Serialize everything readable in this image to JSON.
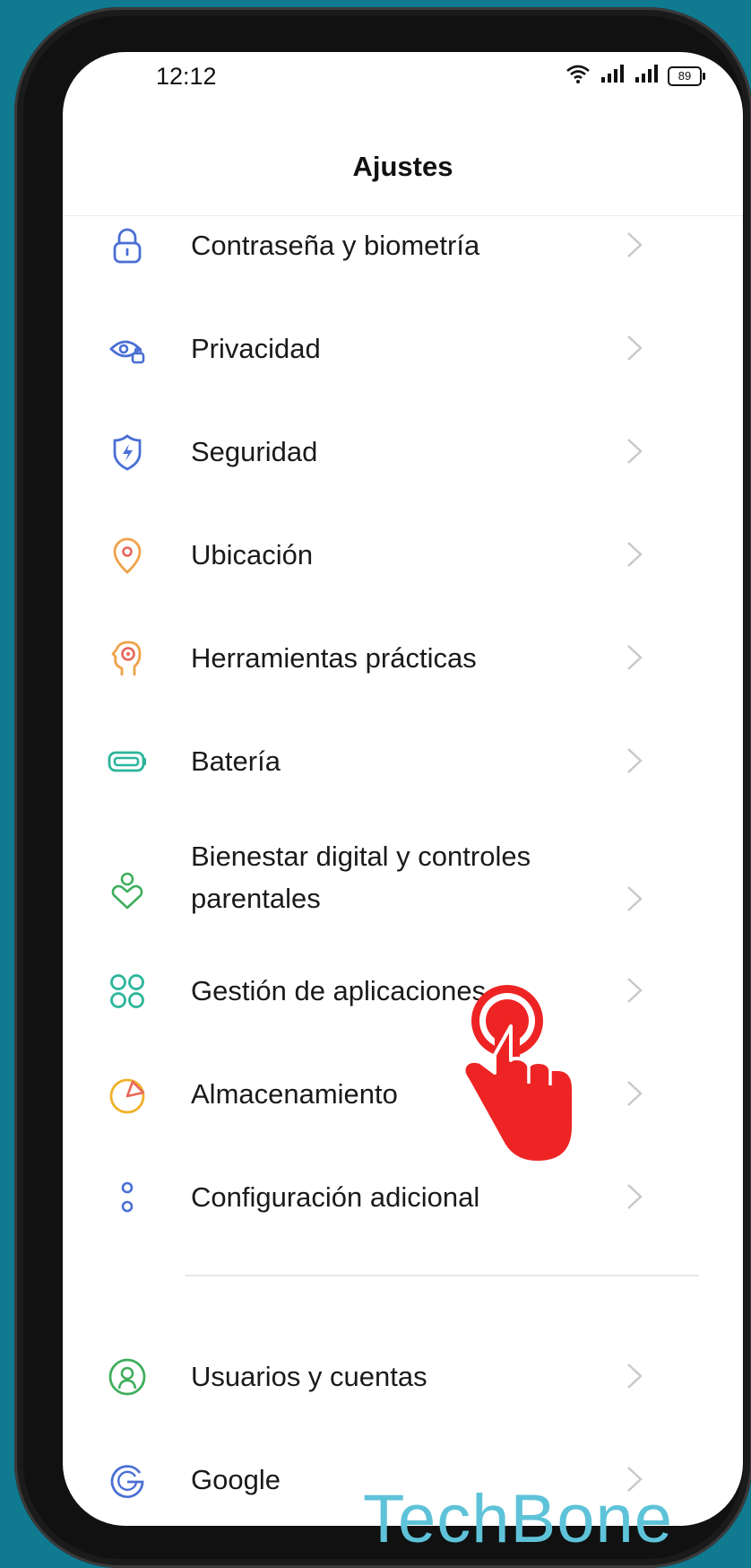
{
  "status_bar": {
    "time": "12:12",
    "battery_level": "89"
  },
  "header": {
    "title": "Ajustes"
  },
  "colors": {
    "background": "#0f7a90",
    "watermark": "#5ec3d9",
    "tap_hand": "#ee2424",
    "chevron": "#c8c8c8"
  },
  "settings": {
    "items": [
      {
        "label": "Contraseña y biometría",
        "icon": "lock-icon"
      },
      {
        "label": "Privacidad",
        "icon": "privacy-eye-icon"
      },
      {
        "label": "Seguridad",
        "icon": "security-shield-icon"
      },
      {
        "label": "Ubicación",
        "icon": "location-pin-icon"
      },
      {
        "label": "Herramientas prácticas",
        "icon": "tools-head-icon"
      },
      {
        "label": "Batería",
        "icon": "battery-icon"
      },
      {
        "label": "Bienestar digital y controles parentales",
        "icon": "wellbeing-heart-icon"
      },
      {
        "label": "Gestión de aplicaciones",
        "icon": "apps-grid-icon"
      },
      {
        "label": "Almacenamiento",
        "icon": "storage-pie-icon"
      },
      {
        "label": "Configuración adicional",
        "icon": "additional-settings-icon"
      }
    ],
    "accounts": [
      {
        "label": "Usuarios y cuentas",
        "icon": "user-icon"
      },
      {
        "label": "Google",
        "icon": "google-icon"
      }
    ]
  },
  "watermark": {
    "text": "TechBone"
  }
}
